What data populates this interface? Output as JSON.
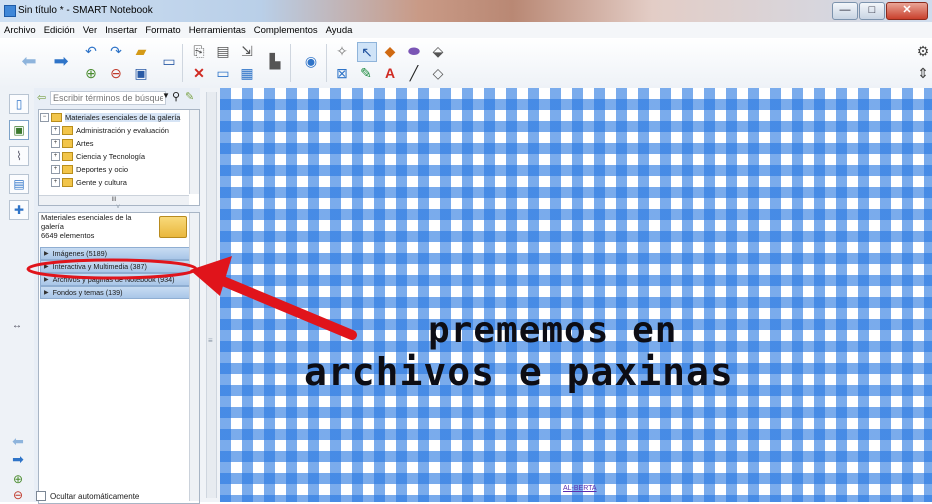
{
  "window": {
    "title": "Sin título * - SMART Notebook",
    "min_symbol": "—",
    "max_symbol": "□",
    "close_symbol": "✕"
  },
  "menu": [
    "Archivo",
    "Edición",
    "Ver",
    "Insertar",
    "Formato",
    "Herramientas",
    "Complementos",
    "Ayuda"
  ],
  "toolbar": {
    "icons": [
      "back-arrow",
      "forward-arrow",
      "undo",
      "redo",
      "new-page",
      "delete-page",
      "open-file",
      "save-file",
      "display",
      "paste",
      "delete",
      "screen-shade",
      "table",
      "full-screen",
      "document-camera",
      "record",
      "clear",
      "select",
      "shapes",
      "eraser",
      "fill",
      "pen",
      "text",
      "line",
      "magic-pen",
      "settings",
      "toolbar-position"
    ],
    "accent": "#1f5fb4"
  },
  "gallery": {
    "search_placeholder": "Escribir términos de búsque",
    "tree": [
      "Materiales esenciales de la galería",
      "Administración y evaluación",
      "Artes",
      "Ciencia y Tecnología",
      "Deportes y ocio",
      "Gente y cultura"
    ],
    "scroll_grip": "III",
    "splitter_grip": "˅",
    "info_title_1": "Materiales esenciales de la",
    "info_title_2": "galería",
    "info_count": "6649 elementos",
    "categories": [
      "Imágenes (5189)",
      "Interactiva y Multimedia (387)",
      "Archivos y páginas de Notebook (934)",
      "Fondos y temas (139)"
    ],
    "autohide_label": "Ocultar automáticamente"
  },
  "dock": {
    "resize_symbol": "↔"
  },
  "canvas": {
    "line1": "prememos en",
    "line2": "archivos e paxinas",
    "caption": "AL-BERTA",
    "pattern_color": "#2878e1"
  },
  "annotation": {
    "color": "#e0141b",
    "target": "Archivos y páginas de Notebook (934)"
  }
}
